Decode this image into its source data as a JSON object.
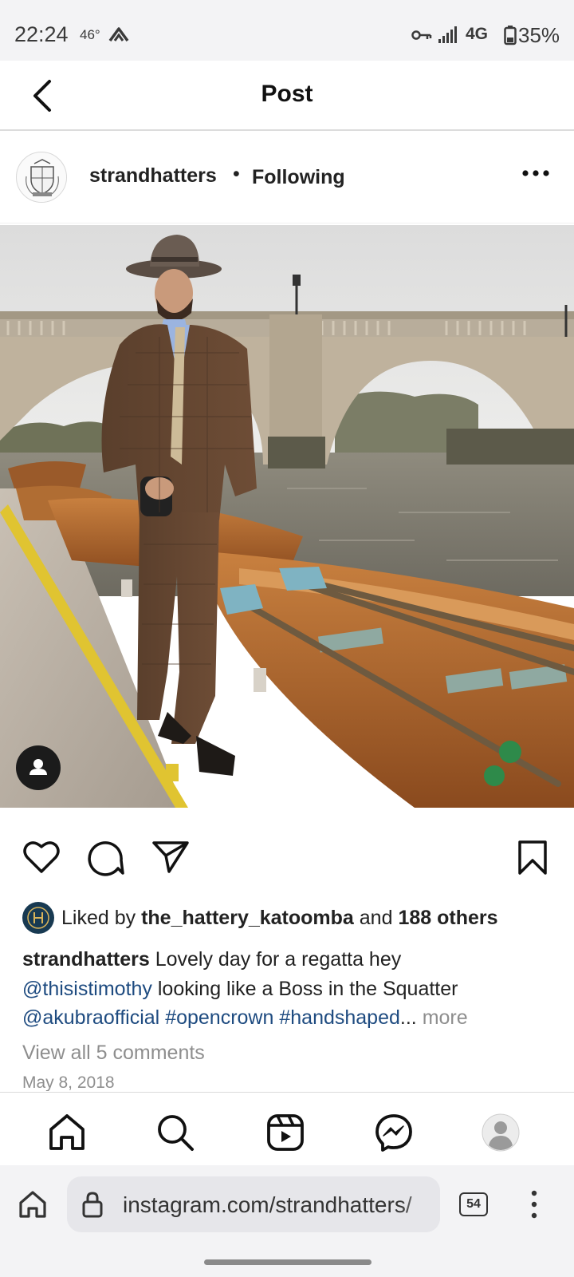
{
  "status_bar": {
    "time": "22:24",
    "temperature": "46°",
    "network": "4G",
    "battery": "35%"
  },
  "header": {
    "title": "Post",
    "back_icon": "chevron-left-icon"
  },
  "post": {
    "username": "strandhatters",
    "separator": "•",
    "follow_status": "Following",
    "more_icon": "more-horizontal-icon",
    "photo_description_icon": "photo",
    "tag_icon": "user-tag-icon"
  },
  "actions": {
    "like_icon": "heart-icon",
    "comment_icon": "comment-icon",
    "share_icon": "send-icon",
    "save_icon": "bookmark-icon"
  },
  "likes": {
    "prefix": "Liked by",
    "user": "the_hattery_katoomba",
    "and": "and",
    "others": "188 others"
  },
  "caption": {
    "username": "strandhatters",
    "text_1": "Lovely day for a regatta hey",
    "mention_1": "@thisistimothy",
    "text_2": "looking like a Boss in the Squatter",
    "mention_2": "@akubraofficial",
    "hashtag_1": "#opencrown",
    "hashtag_2": "#handshaped",
    "ellipsis": "...",
    "more": "more"
  },
  "view_comments": "View all 5 comments",
  "date": "May 8, 2018",
  "bottom_nav": {
    "items": [
      "home-icon",
      "search-icon",
      "reels-icon",
      "messenger-icon",
      "profile-icon"
    ]
  },
  "browser": {
    "url": "instagram.com/strandhatters/",
    "tab_count": "54"
  },
  "colors": {
    "link": "#1e4b80",
    "muted": "#8e8e8e",
    "status_bar_bg": "#f3f3f5"
  }
}
